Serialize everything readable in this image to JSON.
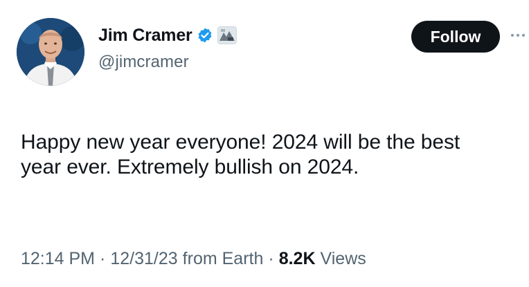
{
  "author": {
    "display_name": "Jim Cramer",
    "handle": "@jimcramer",
    "verified": true,
    "verified_color": "#1d9bf0"
  },
  "actions": {
    "follow_label": "Follow",
    "more_icon": "more-dots-icon"
  },
  "tweet": {
    "text": "Happy new year everyone! 2024 will be the best year ever. Extremely bullish on 2024."
  },
  "meta": {
    "time": "12:14 PM",
    "separator": "·",
    "date": "12/31/23",
    "source": "from Earth",
    "views_count": "8.2K",
    "views_label": "Views"
  }
}
